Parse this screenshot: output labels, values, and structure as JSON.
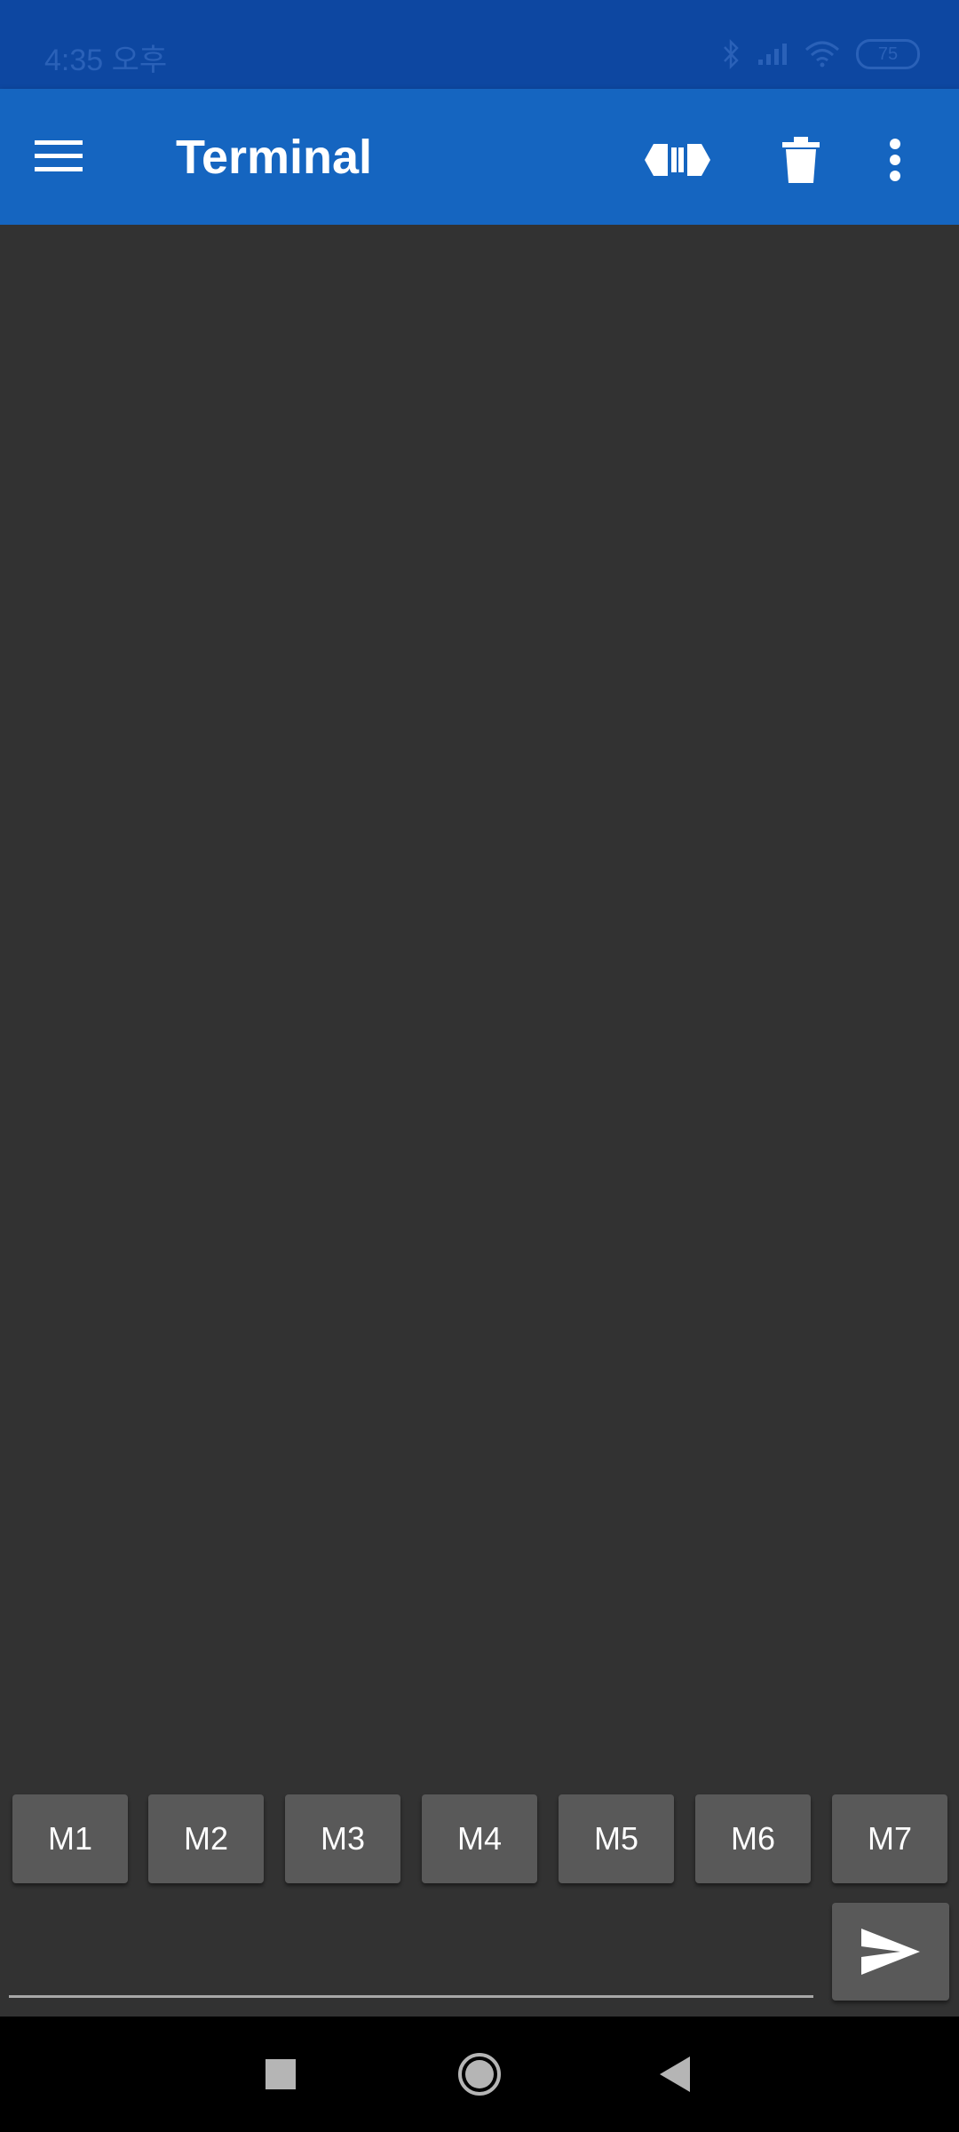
{
  "status_bar": {
    "time": "4:35 오후",
    "battery": "75"
  },
  "app_bar": {
    "title": "Terminal",
    "icons": {
      "menu": "hamburger-menu-icon",
      "connect": "connect-plug-icon",
      "clear": "trash-icon",
      "more": "more-vert-icon"
    }
  },
  "macros": [
    "M1",
    "M2",
    "M3",
    "M4",
    "M5",
    "M6",
    "M7"
  ],
  "input": {
    "value": "",
    "placeholder": ""
  },
  "colors": {
    "status_bar": "#0d47a1",
    "app_bar": "#1565c0",
    "background": "#323232",
    "button": "#595959"
  }
}
